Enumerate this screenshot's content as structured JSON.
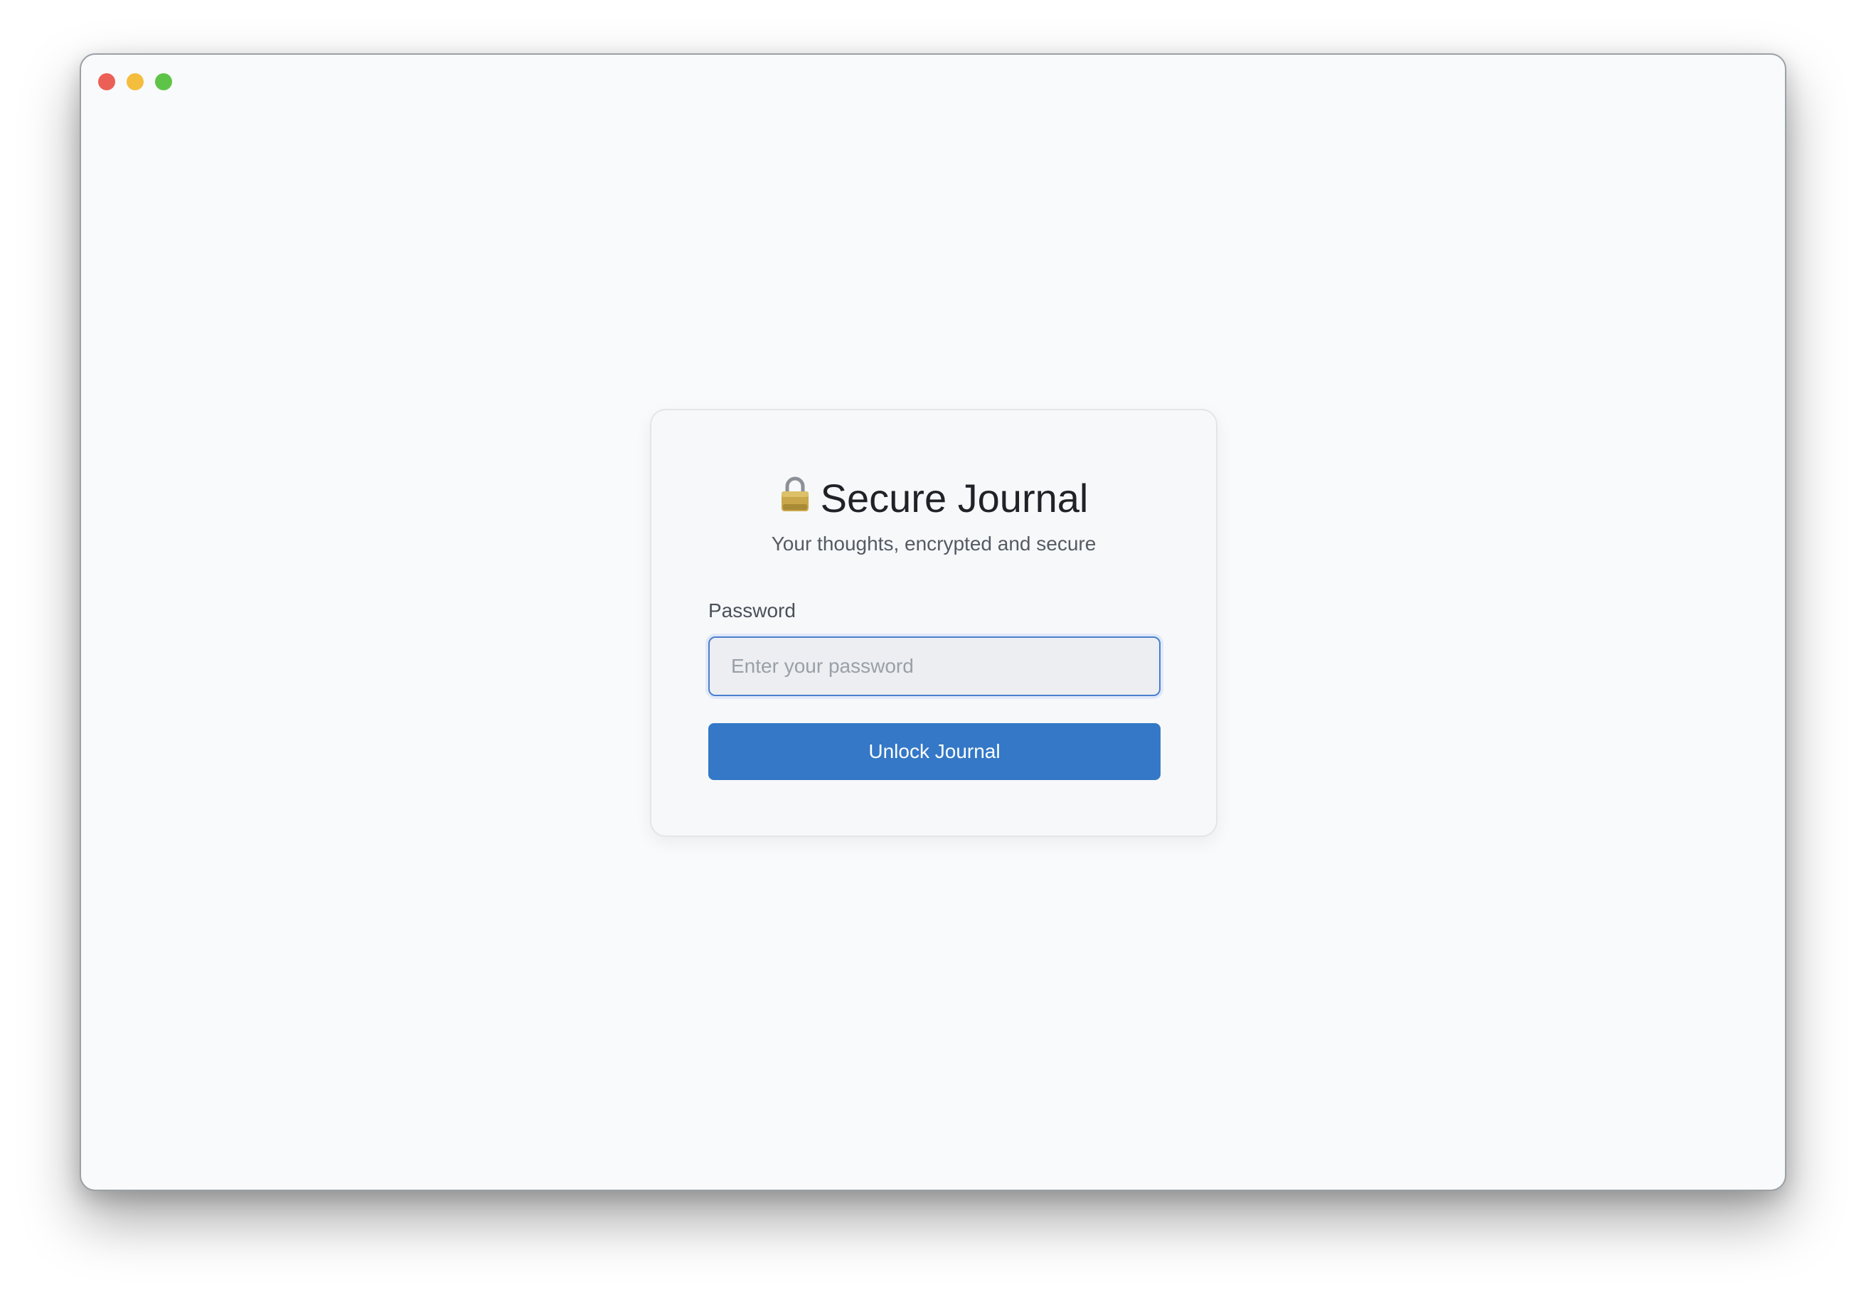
{
  "window": {
    "controls": [
      "close",
      "minimize",
      "maximize"
    ]
  },
  "login": {
    "icon": "lock-icon",
    "title": "Secure Journal",
    "subtitle": "Your thoughts, encrypted and secure",
    "password_label": "Password",
    "password_value": "",
    "password_placeholder": "Enter your password",
    "unlock_label": "Unlock Journal"
  },
  "colors": {
    "accent": "#3478c7",
    "background": "#f9fafb",
    "card": "#f7f8fa",
    "close": "#ec5f57",
    "minimize": "#f4bd3e",
    "maximize": "#5ec447"
  }
}
